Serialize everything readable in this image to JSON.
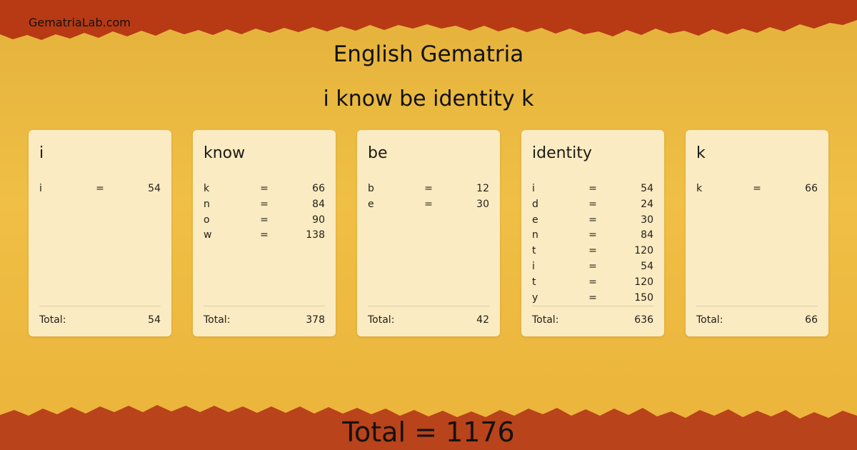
{
  "site": "GematriaLab.com",
  "title": "English Gematria",
  "phrase": "i know be identity k",
  "total_label": "Total:",
  "grand_total": "Total = 1176",
  "colors": {
    "background": "#e8b63a",
    "border_dark": "#b13314",
    "card": "#fcf1d4"
  },
  "cards": [
    {
      "word": "i",
      "letters": [
        {
          "l": "i",
          "eq": "=",
          "v": "54"
        }
      ],
      "total": "54"
    },
    {
      "word": "know",
      "letters": [
        {
          "l": "k",
          "eq": "=",
          "v": "66"
        },
        {
          "l": "n",
          "eq": "=",
          "v": "84"
        },
        {
          "l": "o",
          "eq": "=",
          "v": "90"
        },
        {
          "l": "w",
          "eq": "=",
          "v": "138"
        }
      ],
      "total": "378"
    },
    {
      "word": "be",
      "letters": [
        {
          "l": "b",
          "eq": "=",
          "v": "12"
        },
        {
          "l": "e",
          "eq": "=",
          "v": "30"
        }
      ],
      "total": "42"
    },
    {
      "word": "identity",
      "letters": [
        {
          "l": "i",
          "eq": "=",
          "v": "54"
        },
        {
          "l": "d",
          "eq": "=",
          "v": "24"
        },
        {
          "l": "e",
          "eq": "=",
          "v": "30"
        },
        {
          "l": "n",
          "eq": "=",
          "v": "84"
        },
        {
          "l": "t",
          "eq": "=",
          "v": "120"
        },
        {
          "l": "i",
          "eq": "=",
          "v": "54"
        },
        {
          "l": "t",
          "eq": "=",
          "v": "120"
        },
        {
          "l": "y",
          "eq": "=",
          "v": "150"
        }
      ],
      "total": "636"
    },
    {
      "word": "k",
      "letters": [
        {
          "l": "k",
          "eq": "=",
          "v": "66"
        }
      ],
      "total": "66"
    }
  ]
}
